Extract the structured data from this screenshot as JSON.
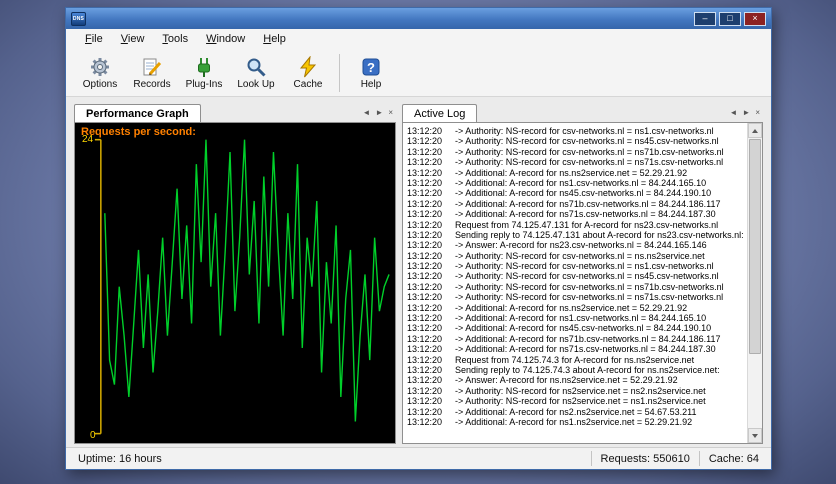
{
  "window": {
    "icon_label": "DNS",
    "controls": {
      "minimize": "–",
      "maximize": "□",
      "close": "×"
    }
  },
  "menu": {
    "items": [
      "File",
      "View",
      "Tools",
      "Window",
      "Help"
    ]
  },
  "toolbar": {
    "buttons": [
      {
        "label": "Options",
        "icon": "gear-icon"
      },
      {
        "label": "Records",
        "icon": "records-icon"
      },
      {
        "label": "Plug-Ins",
        "icon": "plug-icon"
      },
      {
        "label": "Look Up",
        "icon": "lookup-icon"
      },
      {
        "label": "Cache",
        "icon": "cache-icon"
      },
      {
        "label": "Help",
        "icon": "help-icon"
      }
    ]
  },
  "panels": {
    "left_tab": "Performance Graph",
    "right_tab": "Active Log",
    "nav": {
      "prev": "◄",
      "next": "►",
      "close": "×"
    }
  },
  "chart_data": {
    "type": "line",
    "title": "Requests per second:",
    "xlabel": "",
    "ylabel": "Requests per second",
    "ylim": [
      0,
      24
    ],
    "grid": false,
    "legend": "none",
    "title_color": "#ff8000",
    "axis_color": "#d9ae00",
    "label_color": "#ffd700",
    "line_color": "#00d02a",
    "background": "#000000",
    "values": [
      18,
      6,
      4,
      12,
      8,
      3,
      9,
      15,
      7,
      13,
      5,
      10,
      16,
      8,
      14,
      20,
      11,
      17,
      9,
      22,
      14,
      24,
      12,
      18,
      8,
      15,
      23,
      10,
      16,
      24,
      13,
      19,
      9,
      21,
      12,
      23,
      15,
      8,
      18,
      11,
      22,
      7,
      16,
      12,
      19,
      5,
      14,
      9,
      17,
      3,
      11,
      15,
      1,
      8,
      13,
      6,
      16,
      10,
      12,
      13
    ]
  },
  "log": {
    "lines": [
      {
        "time": "13:12:20",
        "msg": "-> Authority: NS-record for csv-networks.nl = ns1.csv-networks.nl"
      },
      {
        "time": "13:12:20",
        "msg": "-> Authority: NS-record for csv-networks.nl = ns45.csv-networks.nl"
      },
      {
        "time": "13:12:20",
        "msg": "-> Authority: NS-record for csv-networks.nl = ns71b.csv-networks.nl"
      },
      {
        "time": "13:12:20",
        "msg": "-> Authority: NS-record for csv-networks.nl = ns71s.csv-networks.nl"
      },
      {
        "time": "13:12:20",
        "msg": "-> Additional: A-record for ns.ns2service.net = 52.29.21.92"
      },
      {
        "time": "13:12:20",
        "msg": "-> Additional: A-record for ns1.csv-networks.nl = 84.244.165.10"
      },
      {
        "time": "13:12:20",
        "msg": "-> Additional: A-record for ns45.csv-networks.nl = 84.244.190.10"
      },
      {
        "time": "13:12:20",
        "msg": "-> Additional: A-record for ns71b.csv-networks.nl = 84.244.186.117"
      },
      {
        "time": "13:12:20",
        "msg": "-> Additional: A-record for ns71s.csv-networks.nl = 84.244.187.30"
      },
      {
        "time": "13:12:20",
        "msg": "Request from 74.125.47.131 for A-record for ns23.csv-networks.nl"
      },
      {
        "time": "13:12:20",
        "msg": "Sending reply to 74.125.47.131 about A-record for ns23.csv-networks.nl:"
      },
      {
        "time": "13:12:20",
        "msg": "-> Answer: A-record for ns23.csv-networks.nl = 84.244.165.146"
      },
      {
        "time": "13:12:20",
        "msg": "-> Authority: NS-record for csv-networks.nl = ns.ns2service.net"
      },
      {
        "time": "13:12:20",
        "msg": "-> Authority: NS-record for csv-networks.nl = ns1.csv-networks.nl"
      },
      {
        "time": "13:12:20",
        "msg": "-> Authority: NS-record for csv-networks.nl = ns45.csv-networks.nl"
      },
      {
        "time": "13:12:20",
        "msg": "-> Authority: NS-record for csv-networks.nl = ns71b.csv-networks.nl"
      },
      {
        "time": "13:12:20",
        "msg": "-> Authority: NS-record for csv-networks.nl = ns71s.csv-networks.nl"
      },
      {
        "time": "13:12:20",
        "msg": "-> Additional: A-record for ns.ns2service.net = 52.29.21.92"
      },
      {
        "time": "13:12:20",
        "msg": "-> Additional: A-record for ns1.csv-networks.nl = 84.244.165.10"
      },
      {
        "time": "13:12:20",
        "msg": "-> Additional: A-record for ns45.csv-networks.nl = 84.244.190.10"
      },
      {
        "time": "13:12:20",
        "msg": "-> Additional: A-record for ns71b.csv-networks.nl = 84.244.186.117"
      },
      {
        "time": "13:12:20",
        "msg": "-> Additional: A-record for ns71s.csv-networks.nl = 84.244.187.30"
      },
      {
        "time": "13:12:20",
        "msg": "Request from 74.125.74.3 for A-record for ns.ns2service.net"
      },
      {
        "time": "13:12:20",
        "msg": "Sending reply to 74.125.74.3 about A-record for ns.ns2service.net:"
      },
      {
        "time": "13:12:20",
        "msg": "-> Answer: A-record for ns.ns2service.net = 52.29.21.92"
      },
      {
        "time": "13:12:20",
        "msg": "-> Authority: NS-record for ns2service.net = ns2.ns2service.net"
      },
      {
        "time": "13:12:20",
        "msg": "-> Authority: NS-record for ns2service.net = ns1.ns2service.net"
      },
      {
        "time": "13:12:20",
        "msg": "-> Additional: A-record for ns2.ns2service.net = 54.67.53.211"
      },
      {
        "time": "13:12:20",
        "msg": "-> Additional: A-record for ns1.ns2service.net = 52.29.21.92"
      }
    ]
  },
  "status": {
    "uptime": "Uptime: 16 hours",
    "requests": "Requests: 550610",
    "cache": "Cache: 64"
  }
}
